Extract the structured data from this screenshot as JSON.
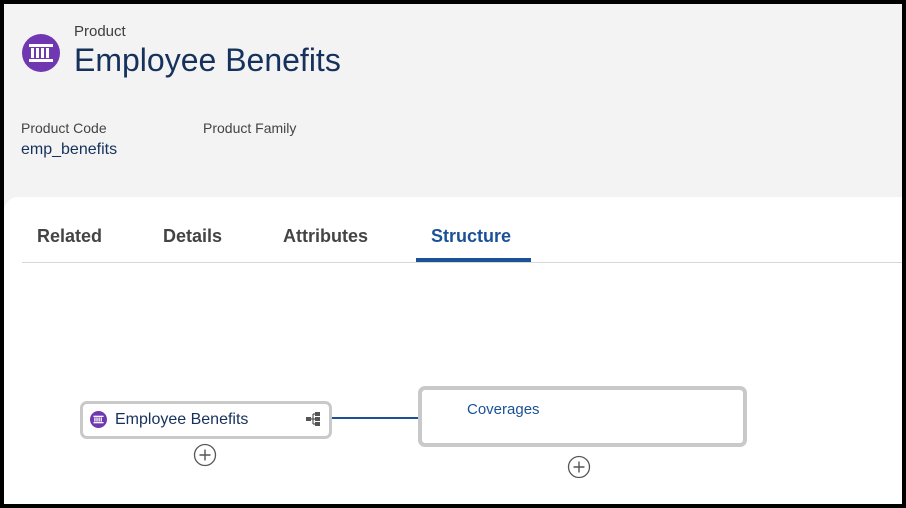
{
  "header": {
    "object_label": "Product",
    "title": "Employee Benefits",
    "icon": "product-icon",
    "accent_color": "#6f38b0",
    "fields": [
      {
        "label": "Product Code",
        "value": "emp_benefits"
      },
      {
        "label": "Product Family",
        "value": ""
      }
    ]
  },
  "tabs": [
    {
      "label": "Related",
      "active": false
    },
    {
      "label": "Details",
      "active": false
    },
    {
      "label": "Attributes",
      "active": false
    },
    {
      "label": "Structure",
      "active": true
    }
  ],
  "structure": {
    "root": {
      "label": "Employee Benefits",
      "icon": "product-icon",
      "action_icon": "hierarchy-icon"
    },
    "children": [
      {
        "label": "Coverages"
      }
    ],
    "add_icon": "add-circle-icon"
  },
  "colors": {
    "brand_blue": "#1b5297",
    "text_dark": "#16325c",
    "node_border": "#c9c9c9"
  }
}
